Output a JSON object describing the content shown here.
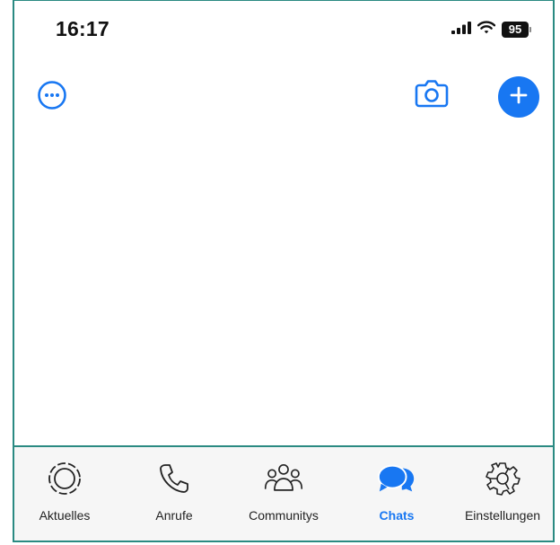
{
  "status_bar": {
    "time": "16:17",
    "battery_level": "95"
  },
  "header": {
    "more_icon": "ellipsis-circle-icon",
    "camera_icon": "camera-icon",
    "new_chat_icon": "plus-icon"
  },
  "tab_bar": {
    "active_tab": "Chats",
    "tabs": [
      {
        "label": "Aktuelles",
        "icon": "updates-icon"
      },
      {
        "label": "Anrufe",
        "icon": "phone-icon"
      },
      {
        "label": "Communitys",
        "icon": "communities-icon"
      },
      {
        "label": "Chats",
        "icon": "chat-bubbles-icon"
      },
      {
        "label": "Einstellungen",
        "icon": "settings-gear-icon"
      }
    ]
  },
  "colors": {
    "accent": "#1877f2",
    "frame_border": "#2a8a82",
    "tab_bar_background": "#f6f6f6"
  }
}
